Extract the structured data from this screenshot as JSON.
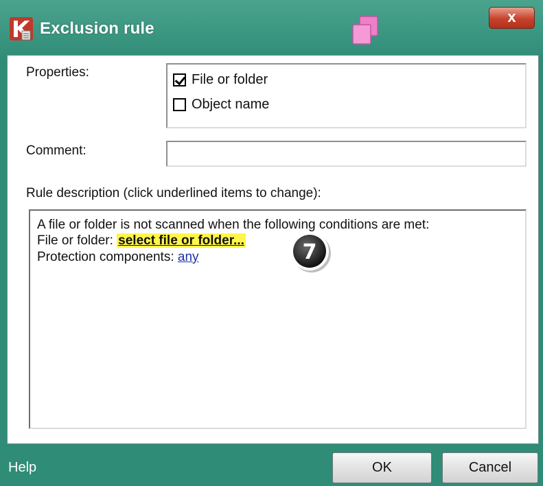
{
  "window": {
    "title": "Exclusion rule",
    "close_label": "x",
    "colors": {
      "frame": "#2e8c77",
      "close": "#c7422c",
      "highlight": "#fff64a",
      "link": "#1a32a8"
    }
  },
  "icons": {
    "app": "kaspersky-k-icon",
    "switch": "pink-windows-icon",
    "badge": "step-number-badge"
  },
  "properties": {
    "label": "Properties:",
    "items": [
      {
        "label": "File or folder",
        "checked": true
      },
      {
        "label": "Object name",
        "checked": false
      }
    ]
  },
  "comment": {
    "label": "Comment:",
    "value": ""
  },
  "rule_description": {
    "label": "Rule description (click underlined items to change):",
    "line1": "A file or folder is not scanned when the following conditions are met:",
    "line2_prefix": "File or folder: ",
    "line2_link": "select file or folder...",
    "line3_prefix": "Protection components: ",
    "line3_link": "any"
  },
  "step_badge": "7",
  "footer": {
    "help": "Help",
    "ok": "OK",
    "cancel": "Cancel"
  }
}
